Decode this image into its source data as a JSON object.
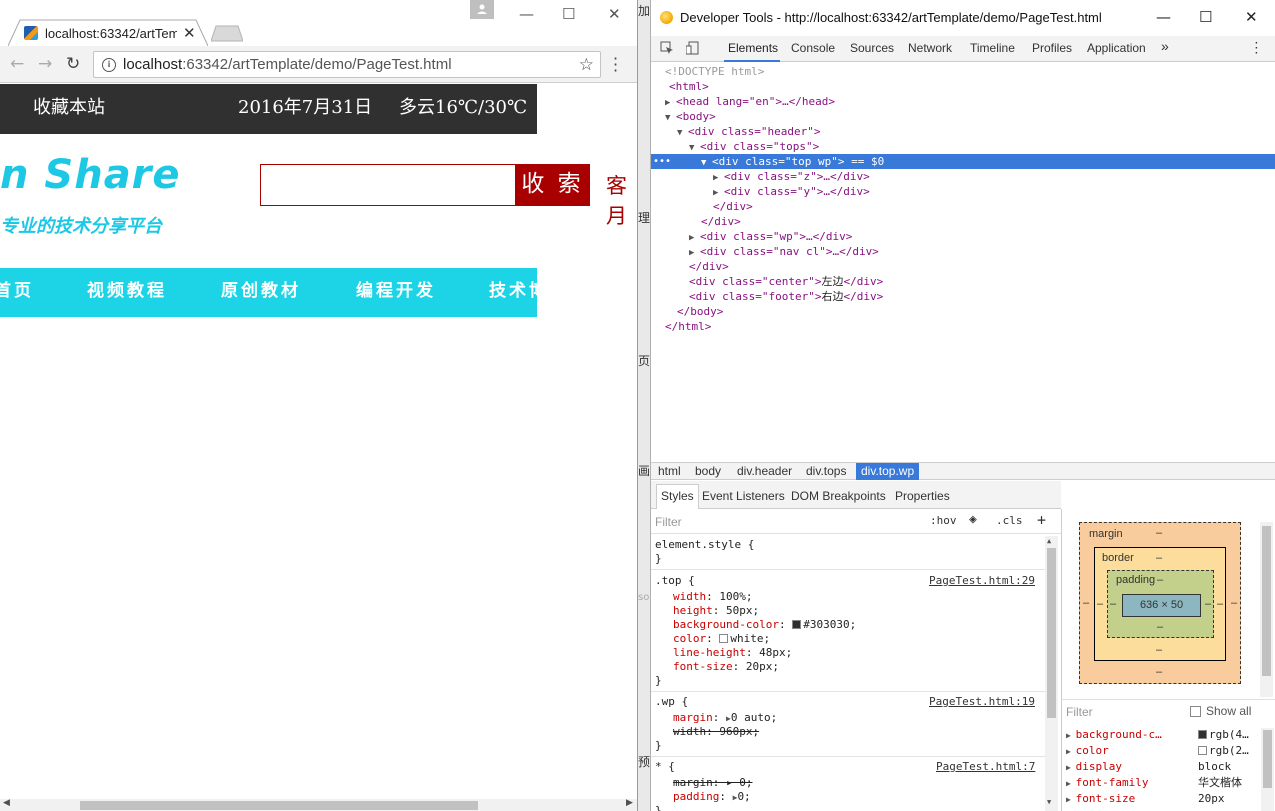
{
  "browser": {
    "tab_title": "localhost:63342/artTem",
    "url_host": "localhost",
    "url_rest": ":63342/artTemplate/demo/PageTest.html"
  },
  "page": {
    "fav_label": "收藏本站",
    "date": "2016年7月31日",
    "weather": "多云16℃/30℃",
    "logo": "n Share",
    "slogan": "专业的技术分享平台",
    "search_button": "收 索",
    "service": "客月",
    "nav": [
      "首页",
      "视频教程",
      "原创教材",
      "编程开发",
      "技术博"
    ]
  },
  "sliver": [
    "加",
    "理",
    "页",
    "画",
    "so",
    "预"
  ],
  "devtools": {
    "title": "Developer Tools - http://localhost:63342/artTemplate/demo/PageTest.html",
    "tabs": [
      "Elements",
      "Console",
      "Sources",
      "Network",
      "Timeline",
      "Profiles",
      "Application"
    ],
    "more": "»",
    "dom": {
      "doctype": "<!DOCTYPE html>",
      "html_open": "<html>",
      "head": "<head lang=\"en\">…</head>",
      "body_open": "<body>",
      "div_header": "<div class=\"header\">",
      "div_tops": "<div class=\"tops\">",
      "div_topwp": "<div class=\"top wp\">",
      "sel_suffix": " == $0",
      "div_z": "<div class=\"z\">…</div>",
      "div_y": "<div class=\"y\">…</div>",
      "div_close": "</div>",
      "div_wp": "<div class=\"wp\">…</div>",
      "div_nav": "<div class=\"nav cl\">…</div>",
      "div_center_tag": "<div class=\"center\">",
      "center_text": "左边",
      "div_footer_tag": "<div class=\"footer\">",
      "footer_text": "右边",
      "body_close": "</body>",
      "html_close": "</html>"
    },
    "breadcrumbs": [
      "html",
      "body",
      "div.header",
      "div.tops",
      "div.top.wp"
    ],
    "subtabs": [
      "Styles",
      "Event Listeners",
      "DOM Breakpoints",
      "Properties"
    ],
    "styles": {
      "filter": "Filter",
      "hov": ":hov",
      "cls": ".cls",
      "plus": "+",
      "element_style": "element.style {",
      "close": "}",
      "top_sel": ".top {",
      "top_src": "PageTest.html:29",
      "top_props": [
        {
          "k": "width",
          "v": "100%;"
        },
        {
          "k": "height",
          "v": "50px;"
        },
        {
          "k": "background-color",
          "v": "#303030;"
        },
        {
          "k": "color",
          "v": "white;"
        },
        {
          "k": "line-height",
          "v": "48px;"
        },
        {
          "k": "font-size",
          "v": "20px;"
        }
      ],
      "wp_sel": ".wp {",
      "wp_src": "PageTest.html:19",
      "wp_margin_k": "margin",
      "wp_margin_v": "0 auto;",
      "wp_width": "width: 960px;",
      "star_sel": "* {",
      "star_src": "PageTest.html:7",
      "star_margin": "margin: ▸ 0;",
      "star_padding_k": "padding",
      "star_padding_v": "0;",
      "color_303030": "#303030",
      "color_white": "#ffffff"
    },
    "boxmodel": {
      "margin": "margin",
      "border": "border",
      "padding": "padding",
      "dash": "–",
      "content": "636 × 50"
    },
    "computed": {
      "filter": "Filter",
      "show_all": "Show all",
      "rows": [
        {
          "k": "background-c…",
          "v": "rgb(4…"
        },
        {
          "k": "color",
          "v": "rgb(2…"
        },
        {
          "k": "display",
          "v": "block"
        },
        {
          "k": "font-family",
          "v": "华文楷体"
        },
        {
          "k": "font-size",
          "v": "20px"
        }
      ]
    }
  }
}
